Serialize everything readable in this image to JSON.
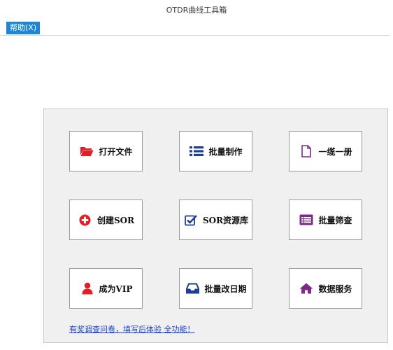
{
  "window": {
    "title": "OTDR曲线工具箱"
  },
  "menu": {
    "help_label": "帮助(X)"
  },
  "tiles": [
    {
      "label": "打开文件",
      "icon": "folder-open-icon",
      "color": "#e41e24"
    },
    {
      "label": "批量制作",
      "icon": "list-icon",
      "color": "#1c3f94"
    },
    {
      "label": "一缆一册",
      "icon": "document-icon",
      "color": "#7b2a86"
    },
    {
      "label": "创建SOR",
      "icon": "plus-circle-icon",
      "color": "#e41e24"
    },
    {
      "label": "SOR资源库",
      "icon": "checkbox-icon",
      "color": "#1c3f94"
    },
    {
      "label": "批量筛查",
      "icon": "card-list-icon",
      "color": "#7b2a86"
    },
    {
      "label": "成为VIP",
      "icon": "user-icon",
      "color": "#e41e24"
    },
    {
      "label": "批量改日期",
      "icon": "inbox-icon",
      "color": "#1c3f94"
    },
    {
      "label": "数据服务",
      "icon": "home-icon",
      "color": "#7b2a86"
    }
  ],
  "survey_link": "有奖调查问卷，填写后体验 全功能！",
  "colors": {
    "menu_accent": "#1d87d6",
    "link": "#1a3fcc",
    "panel_bg": "#f0f0f0"
  }
}
